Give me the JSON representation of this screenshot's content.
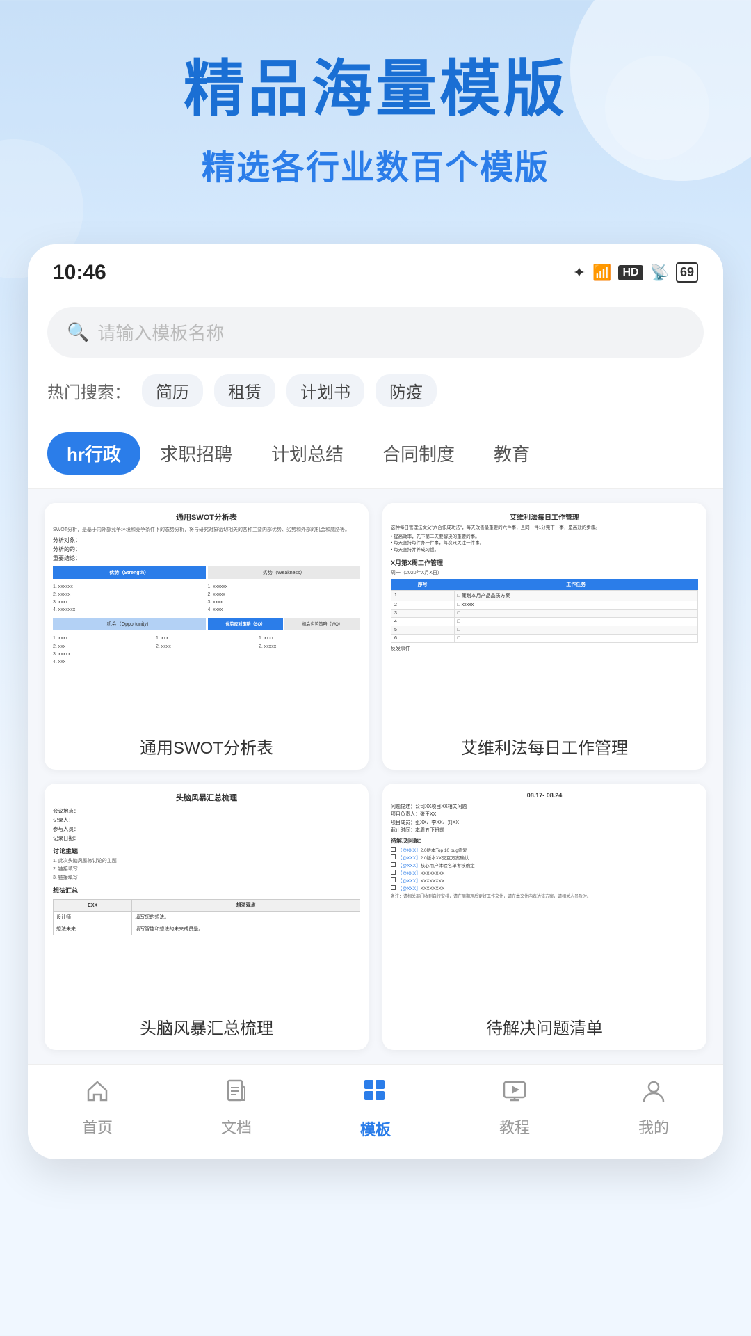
{
  "hero": {
    "title": "精品海量模版",
    "subtitle": "精选各行业数百个模版"
  },
  "phone": {
    "status_time": "10:46",
    "search_placeholder": "请输入模板名称",
    "hot_search_label": "热门搜索：",
    "hot_tags": [
      "简历",
      "租赁",
      "计划书",
      "防疫"
    ],
    "categories": [
      {
        "label": "hr行政",
        "active": true
      },
      {
        "label": "求职招聘",
        "active": false
      },
      {
        "label": "计划总结",
        "active": false
      },
      {
        "label": "合同制度",
        "active": false
      },
      {
        "label": "教育",
        "active": false
      }
    ],
    "templates": [
      {
        "id": "swot",
        "label": "通用SWOT分析表"
      },
      {
        "id": "aiwei",
        "label": "艾维利法每日工作管理"
      },
      {
        "id": "brain",
        "label": "头脑风暴汇总梳理"
      },
      {
        "id": "problem",
        "label": "待解决问题清单"
      }
    ],
    "nav": [
      {
        "label": "首页",
        "icon": "🏠",
        "active": false
      },
      {
        "label": "文档",
        "icon": "📄",
        "active": false
      },
      {
        "label": "模板",
        "icon": "📦",
        "active": true
      },
      {
        "label": "教程",
        "icon": "🖼",
        "active": false
      },
      {
        "label": "我的",
        "icon": "👤",
        "active": false
      }
    ]
  }
}
